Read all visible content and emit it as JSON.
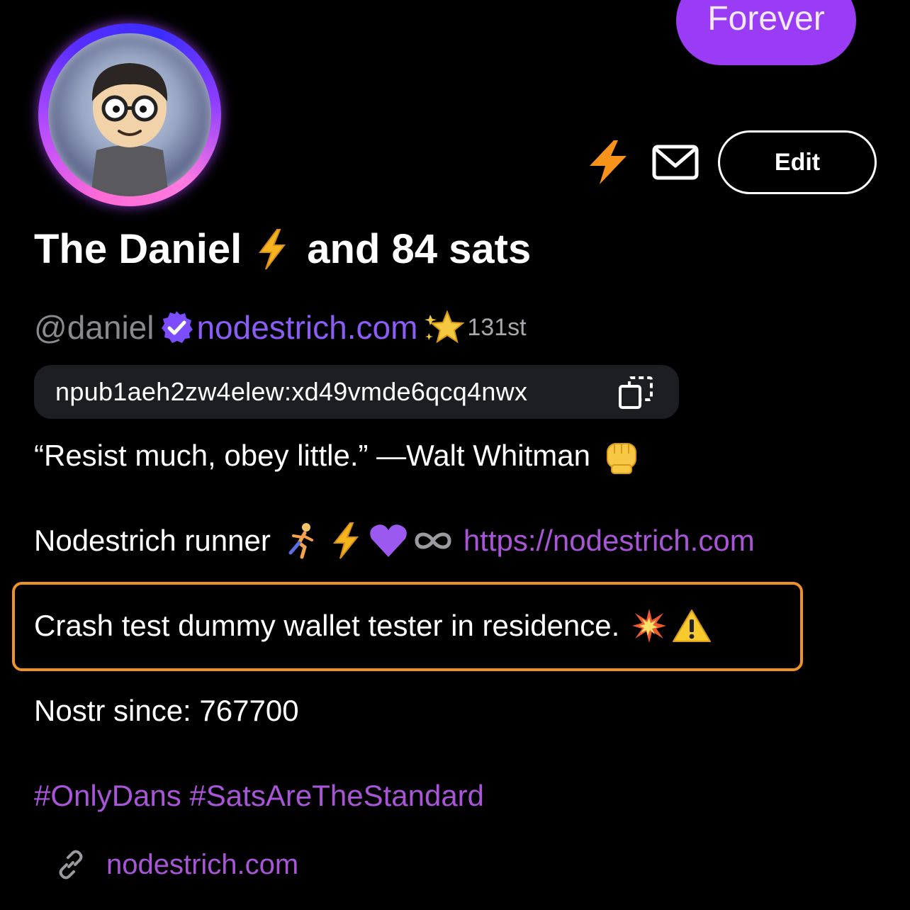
{
  "header": {
    "forever_label": "Forever",
    "edit_label": "Edit"
  },
  "profile": {
    "name_part1": "The Daniel",
    "name_part2": "and 84 sats",
    "handle": "@daniel",
    "nip05": "nodestrich.com",
    "rank": "131st",
    "npub": "npub1aeh2zw4elew:xd49vmde6qcq4nwx"
  },
  "bio": {
    "quote": "“Resist much, obey little.” —Walt Whitman",
    "runner": "Nodestrich runner",
    "runner_link": "https://nodestrich.com",
    "crash": "Crash test dummy wallet tester in residence.",
    "since": "Nostr since: 767700",
    "tags": "#OnlyDans #SatsAreTheStandard"
  },
  "website": "nodestrich.com",
  "colors": {
    "accent_purple": "#9a3cf5",
    "link_purple": "#a855d8",
    "verified_purple": "#8b5cf6",
    "highlight_orange": "#f0922a",
    "zap_orange": "#f7931a"
  },
  "icons": {
    "zap": "lightning-bolt-icon",
    "mail": "envelope-icon",
    "verified": "verified-badge-icon",
    "star": "sparkle-star-icon",
    "copy": "copy-icon",
    "link": "link-icon"
  }
}
